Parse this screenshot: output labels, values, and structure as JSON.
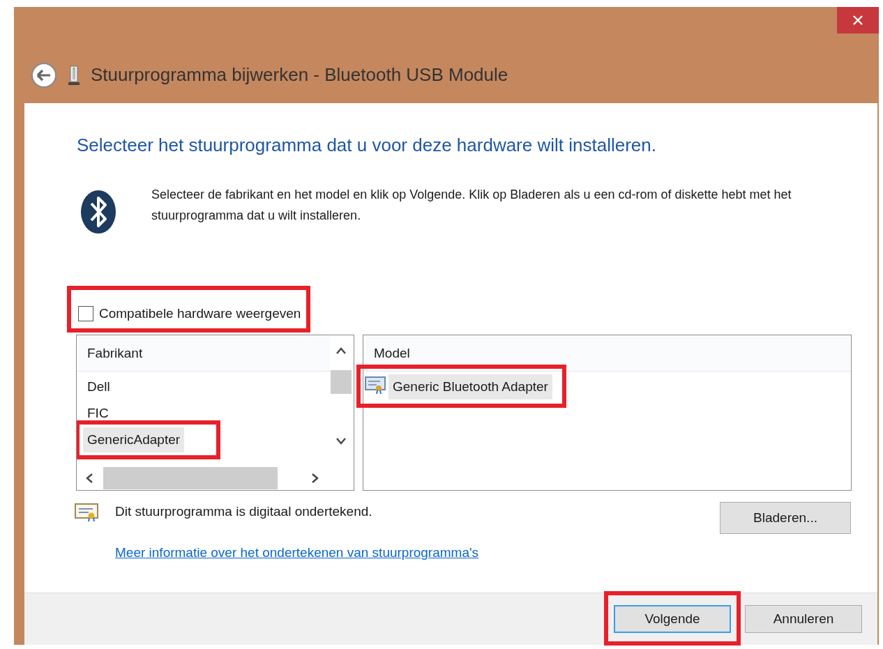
{
  "window": {
    "title": "Stuurprogramma bijwerken - Bluetooth USB Module"
  },
  "heading": "Selecteer het stuurprogramma dat u voor deze hardware wilt installeren.",
  "description": "Selecteer de fabrikant en het model en klik op Volgende. Klik op Bladeren als u een cd-rom of diskette hebt met het stuurprogramma dat u wilt installeren.",
  "compatible_checkbox": {
    "label": "Compatibele hardware weergeven",
    "checked": false,
    "highlighted": true
  },
  "manufacturers": {
    "header": "Fabrikant",
    "items": [
      {
        "label": "Dell",
        "selected": false,
        "highlighted": false
      },
      {
        "label": "FIC",
        "selected": false,
        "highlighted": false
      },
      {
        "label": "GenericAdapter",
        "selected": true,
        "highlighted": true
      }
    ]
  },
  "models": {
    "header": "Model",
    "items": [
      {
        "label": "Generic Bluetooth Adapter",
        "selected": true,
        "highlighted": true
      }
    ]
  },
  "signed_note": "Dit stuurprogramma is digitaal ondertekend.",
  "more_info_link": "Meer informatie over het ondertekenen van stuurprogramma's",
  "browse_button": "Bladeren...",
  "buttons": [
    {
      "label": "Volgende",
      "default": true,
      "highlighted": true
    },
    {
      "label": "Annuleren",
      "default": false,
      "highlighted": false
    }
  ]
}
